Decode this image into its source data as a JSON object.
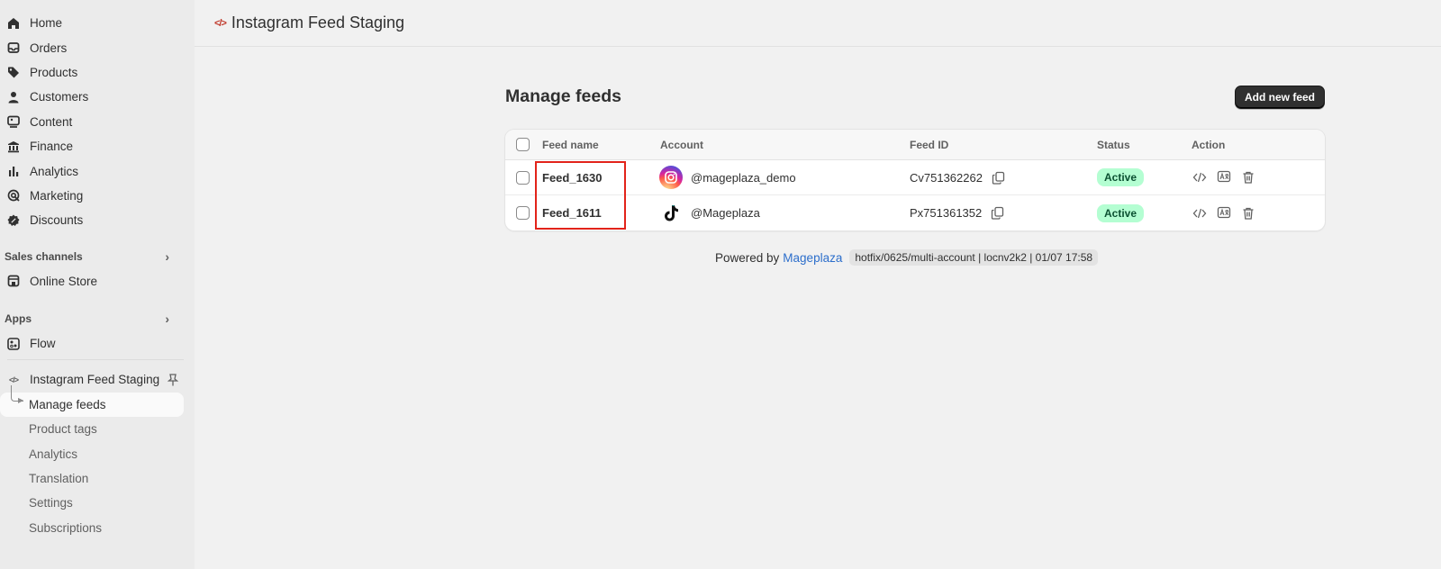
{
  "sidebar": {
    "main_items": [
      {
        "label": "Home",
        "icon": "home-icon"
      },
      {
        "label": "Orders",
        "icon": "inbox-icon"
      },
      {
        "label": "Products",
        "icon": "tag-icon"
      },
      {
        "label": "Customers",
        "icon": "person-icon"
      },
      {
        "label": "Content",
        "icon": "image-icon"
      },
      {
        "label": "Finance",
        "icon": "bank-icon"
      },
      {
        "label": "Analytics",
        "icon": "bar-chart-icon"
      },
      {
        "label": "Marketing",
        "icon": "target-icon"
      },
      {
        "label": "Discounts",
        "icon": "discount-icon"
      }
    ],
    "sales_channels_label": "Sales channels",
    "online_store_label": "Online Store",
    "apps_label": "Apps",
    "flow_label": "Flow",
    "app_name": "Instagram Feed Staging",
    "app_sub_items": [
      {
        "label": "Manage feeds",
        "active": true
      },
      {
        "label": "Product tags",
        "active": false
      },
      {
        "label": "Analytics",
        "active": false
      },
      {
        "label": "Translation",
        "active": false
      },
      {
        "label": "Settings",
        "active": false
      },
      {
        "label": "Subscriptions",
        "active": false
      }
    ]
  },
  "topbar": {
    "icon": "code-icon",
    "title": "Instagram Feed Staging"
  },
  "main": {
    "title": "Manage feeds",
    "add_button_label": "Add new feed",
    "table": {
      "headers": {
        "feed_name": "Feed name",
        "account": "Account",
        "feed_id": "Feed ID",
        "status": "Status",
        "action": "Action"
      },
      "rows": [
        {
          "feed_name": "Feed_1630",
          "account": "@mageplaza_demo",
          "account_icon": "instagram-icon",
          "feed_id": "Cv751362262",
          "status": "Active"
        },
        {
          "feed_name": "Feed_1611",
          "account": "@Mageplaza",
          "account_icon": "tiktok-icon",
          "feed_id": "Px751361352",
          "status": "Active"
        }
      ]
    },
    "footer": {
      "powered_by": "Powered by",
      "link_text": "Mageplaza",
      "version_tag": "hotfix/0625/multi-account | locnv2k2 | 01/07 17:58"
    }
  },
  "colors": {
    "accent_dark": "#303030",
    "status_active_bg": "#b4fed2",
    "link": "#2c6ecb",
    "highlight": "#e2231a"
  }
}
